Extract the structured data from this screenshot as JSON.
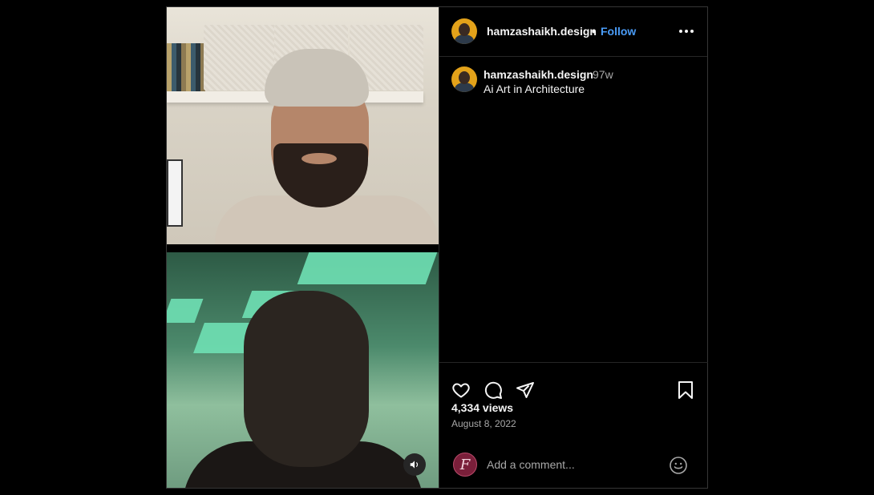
{
  "post": {
    "author": {
      "username": "hamzashaikh.design",
      "separator": "•",
      "follow_label": "Follow"
    },
    "caption": {
      "username": "hamzashaikh.design",
      "age": "97w",
      "text": "Ai Art in Architecture"
    },
    "stats": {
      "views": "4,334 views",
      "date": "August 8, 2022"
    },
    "comment": {
      "placeholder": "Add a comment...",
      "avatar_letter": "F"
    },
    "icons": [
      "heart-icon",
      "comment-icon",
      "share-icon",
      "bookmark-icon",
      "more-icon",
      "volume-icon",
      "emoji-icon"
    ],
    "colors": {
      "follow": "#4a9cf7",
      "background": "#000000",
      "border": "#363636",
      "secondary_text": "#a8a8a8"
    }
  }
}
